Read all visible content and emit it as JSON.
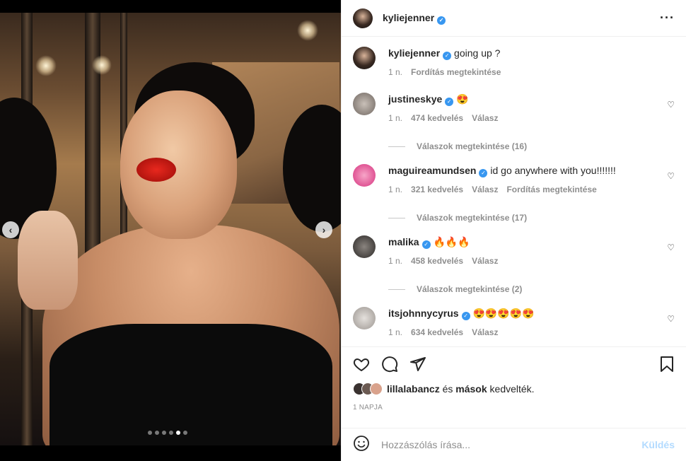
{
  "post": {
    "author": "kyliejenner",
    "more_icon": "more-horizontal-icon",
    "caption_user": "kyliejenner",
    "caption_text": "going up ?",
    "caption_time": "1 n.",
    "caption_translate": "Fordítás megtekintése",
    "carousel": {
      "prev_icon": "chevron-left-icon",
      "next_icon": "chevron-right-icon",
      "count": 6,
      "active_index": 4
    }
  },
  "comments": [
    {
      "user": "justineskye",
      "text": "😍",
      "time": "1 n.",
      "likes": "474 kedvelés",
      "reply": "Válasz",
      "translate": "",
      "replies": "Válaszok megtekintése (16)",
      "avatar_color": "#9a9088"
    },
    {
      "user": "maguireamundsen",
      "text": "id go anywhere with you!!!!!!!",
      "time": "1 n.",
      "likes": "321 kedvelés",
      "reply": "Válasz",
      "translate": "Fordítás megtekintése",
      "replies": "Válaszok megtekintése (17)",
      "avatar_color": "#e0529a"
    },
    {
      "user": "malika",
      "text": "🔥🔥🔥",
      "time": "1 n.",
      "likes": "458 kedvelés",
      "reply": "Válasz",
      "translate": "",
      "replies": "Válaszok megtekintése (2)",
      "avatar_color": "#3d3a38"
    },
    {
      "user": "itsjohnnycyrus",
      "text": "😍😍😍😍😍",
      "time": "1 n.",
      "likes": "634 kedvelés",
      "reply": "Válasz",
      "translate": "",
      "replies": "",
      "avatar_color": "#c8c4c0"
    }
  ],
  "actions": {
    "like_icon": "heart-icon",
    "comment_icon": "comment-icon",
    "share_icon": "send-icon",
    "save_icon": "bookmark-icon",
    "liked_by_user": "lillalabancz",
    "liked_by_and": "és",
    "liked_by_others": "mások",
    "liked_by_suffix": "kedvelték.",
    "date": "1 NAPJA"
  },
  "add_comment": {
    "emoji_icon": "smiley-icon",
    "placeholder": "Hozzászólás írása...",
    "post_label": "Küldés"
  },
  "colors": {
    "verified": "#3897f0",
    "secondary_text": "#8e8e8e",
    "post_disabled": "#b3dbff"
  }
}
